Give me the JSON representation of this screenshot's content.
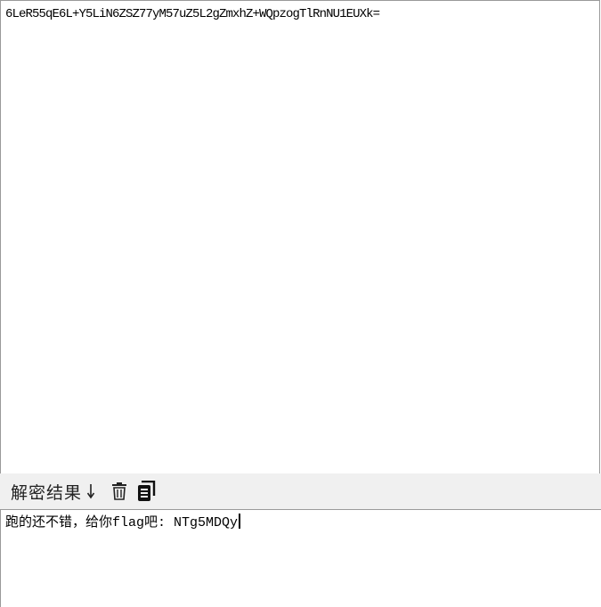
{
  "input": {
    "value": "6LeR55qE6L+Y5LiN6ZSZ77yM57uZ5L2gZmxhZ+WQpzogTlRnNU1EUXk="
  },
  "toolbar": {
    "label": "解密结果",
    "arrow_icon": "down-arrow-icon",
    "trash_icon": "trash-icon",
    "copy_icon": "copy-icon"
  },
  "output": {
    "value": "跑的还不错，给你flag吧: NTg5MDQy"
  }
}
